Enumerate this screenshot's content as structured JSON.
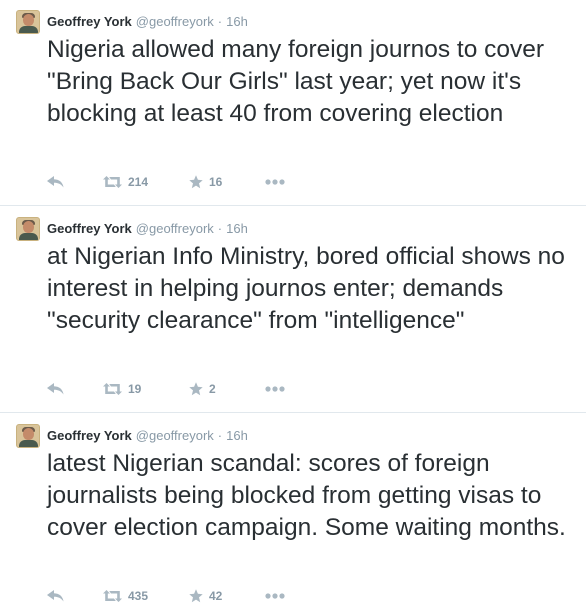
{
  "colors": {
    "text": "#292f33",
    "secondary": "#8899a6",
    "icon": "#aab8c2",
    "divider": "#e1e8ed"
  },
  "icons": [
    "reply-icon",
    "retweet-icon",
    "favorite-star-icon",
    "more-dots-icon"
  ],
  "tweets": [
    {
      "fullname": "Geoffrey York",
      "screenname": "@geoffreyork",
      "separator": "·",
      "time": "16h",
      "text": "Nigeria allowed many foreign journos to cover \"Bring Back Our Girls\" last year; yet now it's blocking at least 40 from covering election",
      "retweets": "214",
      "favorites": "16"
    },
    {
      "fullname": "Geoffrey York",
      "screenname": "@geoffreyork",
      "separator": "·",
      "time": "16h",
      "text": "at Nigerian Info Ministry, bored official shows no interest in helping journos enter; demands \"security clearance\" from \"intelligence\"",
      "retweets": "19",
      "favorites": "2"
    },
    {
      "fullname": "Geoffrey York",
      "screenname": "@geoffreyork",
      "separator": "·",
      "time": "16h",
      "text": "latest Nigerian scandal: scores of foreign journalists being blocked from getting visas to cover election campaign. Some waiting months.",
      "retweets": "435",
      "favorites": "42"
    }
  ]
}
